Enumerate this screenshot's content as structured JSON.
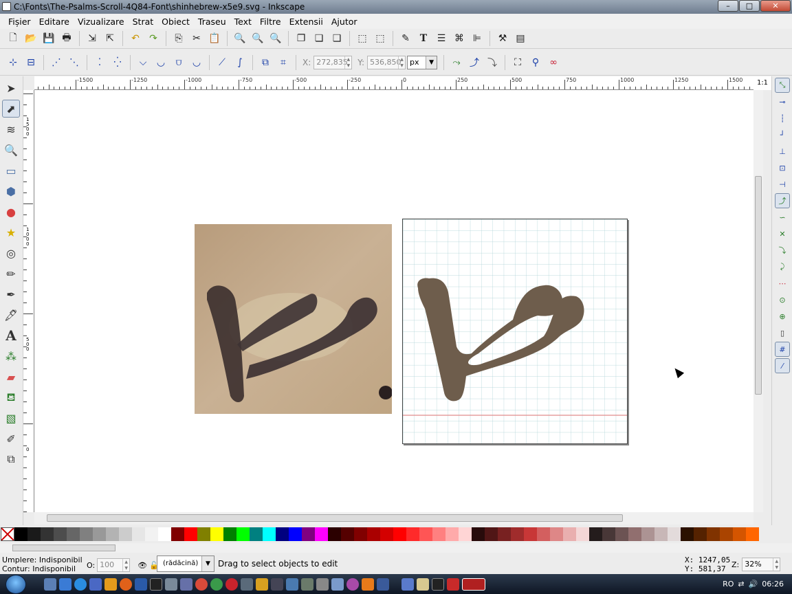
{
  "window": {
    "title": "C:\\Fonts\\The-Psalms-Scroll-4Q84-Font\\shinhebrew-x5e9.svg - Inkscape",
    "buttons": {
      "minimize": "–",
      "maximize": "□",
      "close": "✕"
    }
  },
  "menu": [
    {
      "label": "Fișier"
    },
    {
      "label": "Editare"
    },
    {
      "label": "Vizualizare"
    },
    {
      "label": "Strat"
    },
    {
      "label": "Obiect"
    },
    {
      "label": "Traseu"
    },
    {
      "label": "Text"
    },
    {
      "label": "Filtre"
    },
    {
      "label": "Extensii"
    },
    {
      "label": "Ajutor"
    }
  ],
  "commands_bar": {
    "icons": [
      "new-icon",
      "open-icon",
      "save-icon",
      "print-icon",
      "import-icon",
      "export-icon",
      "undo-icon",
      "redo-icon",
      "copy-icon",
      "cut-icon",
      "paste-icon",
      "zoom-selection-icon",
      "zoom-drawing-icon",
      "zoom-page-icon",
      "duplicate-icon",
      "clone-icon",
      "unlink-clone-icon",
      "group-icon",
      "ungroup-icon",
      "fill-stroke-icon",
      "text-font-icon",
      "layers-icon",
      "xml-editor-icon",
      "align-icon",
      "preferences-icon",
      "document-properties-icon"
    ]
  },
  "node_toolbar": {
    "x_label": "X:",
    "x_value": "272,835",
    "y_label": "Y:",
    "y_value": "536,850",
    "unit": "px"
  },
  "rulers": {
    "horizontal_labels": [
      "-1500",
      "-1250",
      "-1000",
      "-750",
      "-500",
      "-250",
      "0",
      "250",
      "500",
      "750",
      "1000",
      "1250",
      "1500"
    ],
    "vertical_labels": [
      "1500",
      "1000",
      "500",
      "0"
    ]
  },
  "zoom_corner": "1:1",
  "palette": {
    "colors": [
      "#000000",
      "#1a1a1a",
      "#333333",
      "#4d4d4d",
      "#666666",
      "#808080",
      "#999999",
      "#b3b3b3",
      "#cccccc",
      "#e6e6e6",
      "#f2f2f2",
      "#ffffff",
      "#800000",
      "#ff0000",
      "#808000",
      "#ffff00",
      "#008000",
      "#00ff00",
      "#008080",
      "#00ffff",
      "#000080",
      "#0000ff",
      "#800080",
      "#ff00ff",
      "#2b0000",
      "#550000",
      "#800000",
      "#aa0000",
      "#d40000",
      "#ff0000",
      "#ff2a2a",
      "#ff5555",
      "#ff8080",
      "#ffaaaa",
      "#ffd5d5",
      "#280b0b",
      "#501616",
      "#782121",
      "#a02c2c",
      "#c83737",
      "#d35f5f",
      "#de8787",
      "#e9afaf",
      "#f4d7d7",
      "#241c1c",
      "#483737",
      "#6c5353",
      "#916f6f",
      "#ac9393",
      "#c8b7b7",
      "#e3dbdb",
      "#2b1100",
      "#552200",
      "#803300",
      "#aa4400",
      "#d45500",
      "#ff6600"
    ]
  },
  "status": {
    "fill_label": "Umplere:",
    "fill_value": "Indisponibil",
    "stroke_label": "Contur:",
    "stroke_value": "Indisponibil",
    "opacity_label": "O:",
    "opacity_value": "100",
    "layer": "(rădăcină)",
    "message": "Drag to select objects to edit",
    "cursor_x": "X: 1247,05",
    "cursor_y": "Y:  581,37",
    "zoom_label": "Z:",
    "zoom_value": "32%"
  },
  "taskbar": {
    "language": "RO",
    "clock": "06:26"
  }
}
